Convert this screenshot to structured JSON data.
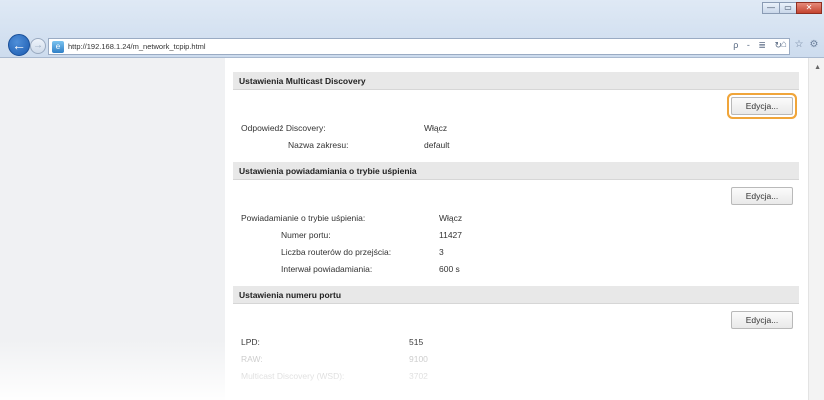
{
  "browser": {
    "url": "http://192.168.1.24/m_network_tcpip.html",
    "address_tools": "ρ - ≣ ↻",
    "window_buttons": {
      "minimize": "—",
      "maximize": "▭",
      "close": "✕"
    }
  },
  "sections": {
    "multicast": {
      "title": "Ustawienia Multicast Discovery",
      "edit_label": "Edycja...",
      "rows": [
        {
          "label": "Odpowiedź Discovery:",
          "value": "Włącz"
        },
        {
          "label": "Nazwa zakresu:",
          "value": "default"
        }
      ]
    },
    "sleep": {
      "title": "Ustawienia powiadamiania o trybie uśpienia",
      "edit_label": "Edycja...",
      "rows": [
        {
          "label": "Powiadamianie o trybie uśpienia:",
          "value": "Włącz"
        },
        {
          "label": "Numer portu:",
          "value": "11427"
        },
        {
          "label": "Liczba routerów do przejścia:",
          "value": "3"
        },
        {
          "label": "Interwał powiadamiania:",
          "value": "600 s"
        }
      ]
    },
    "port": {
      "title": "Ustawienia numeru portu",
      "edit_label": "Edycja...",
      "rows": [
        {
          "label": "LPD:",
          "value": "515"
        },
        {
          "label": "RAW:",
          "value": "9100"
        },
        {
          "label": "Multicast Discovery (WSD):",
          "value": "3702"
        }
      ]
    }
  }
}
